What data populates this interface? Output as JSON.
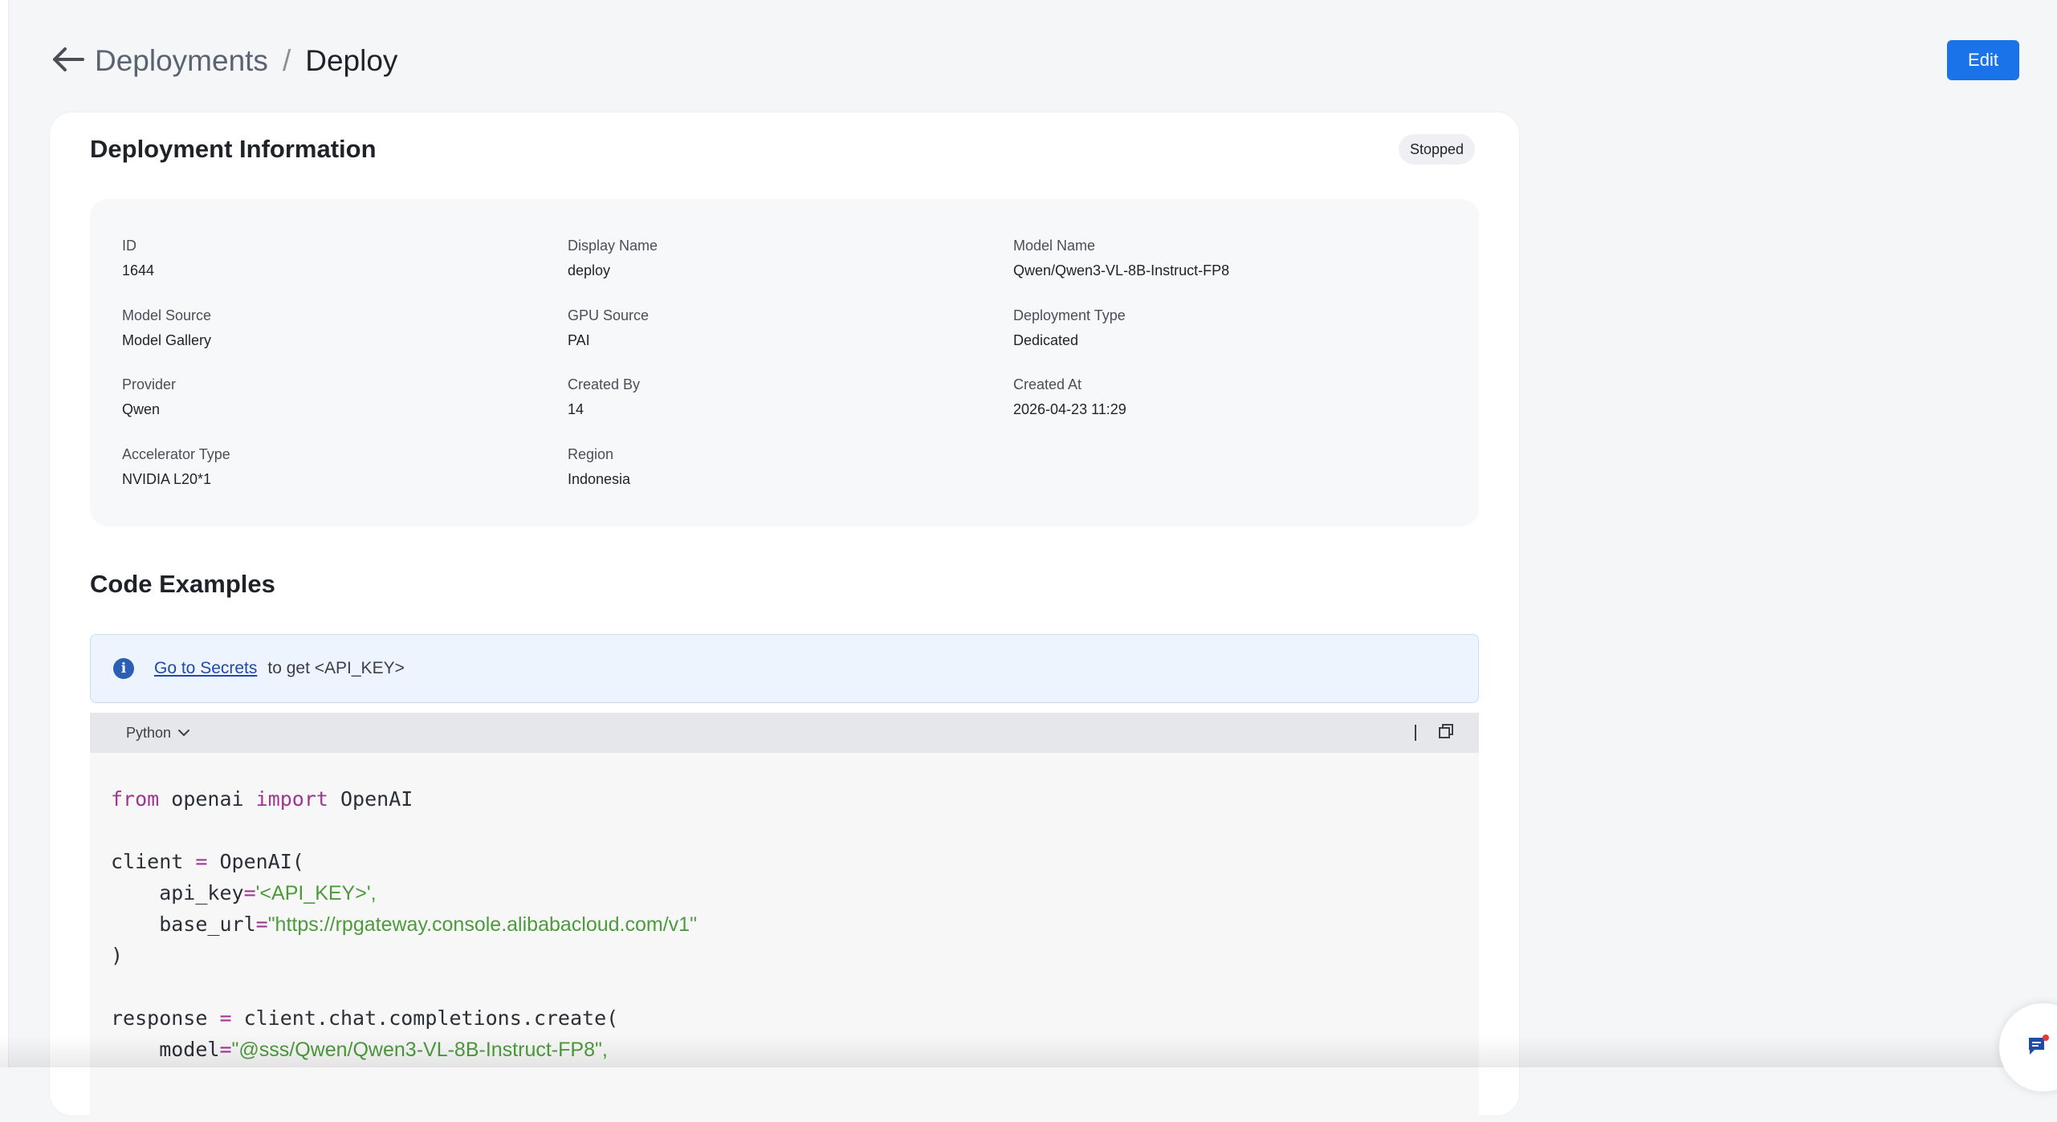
{
  "header": {
    "parent": "Deployments",
    "separator": "/",
    "current": "Deploy",
    "edit_label": "Edit"
  },
  "card": {
    "title": "Deployment Information",
    "status": "Stopped"
  },
  "fields": [
    {
      "label": "ID",
      "value": "1644"
    },
    {
      "label": "Display Name",
      "value": "deploy"
    },
    {
      "label": "Model Name",
      "value": "Qwen/Qwen3-VL-8B-Instruct-FP8"
    },
    {
      "label": "Model Source",
      "value": "Model Gallery"
    },
    {
      "label": "GPU Source",
      "value": "PAI"
    },
    {
      "label": "Deployment Type",
      "value": "Dedicated"
    },
    {
      "label": "Provider",
      "value": "Qwen"
    },
    {
      "label": "Created By",
      "value": "14"
    },
    {
      "label": "Created At",
      "value": "2026-04-23 11:29"
    },
    {
      "label": "Accelerator Type",
      "value": "NVIDIA L20*1"
    },
    {
      "label": "Region",
      "value": "Indonesia"
    }
  ],
  "code_examples": {
    "title": "Code Examples",
    "alert_link": "Go to Secrets",
    "alert_text": "to get <API_KEY>",
    "language": "Python",
    "code": {
      "l1_from": "from",
      "l1_mod": " openai ",
      "l1_import": "import",
      "l1_name": " OpenAI",
      "l2_var": "client ",
      "l2_eq": "=",
      "l2_call": " OpenAI(",
      "l3_key": "    api_key",
      "l3_eq": "=",
      "l3_val": "'<API_KEY>',",
      "l4_key": "    base_url",
      "l4_eq": "=",
      "l4_val": "\"https://rpgateway.console.alibabacloud.com/v1\"",
      "l5": ")",
      "l6_var": "response ",
      "l6_eq": "=",
      "l6_call": " client.chat.completions.create(",
      "l7_key": "    model",
      "l7_eq": "=",
      "l7_val": "\"@sss/Qwen/Qwen3-VL-8B-Instruct-FP8\","
    }
  },
  "icons": {
    "back": "arrow-left-icon",
    "info": "info-icon",
    "chevron": "chevron-down-icon",
    "copy": "copy-icon",
    "chat": "chat-icon"
  },
  "colors": {
    "primary": "#1a73e8",
    "keyword": "#a0378f",
    "string": "#4d9a3c"
  }
}
